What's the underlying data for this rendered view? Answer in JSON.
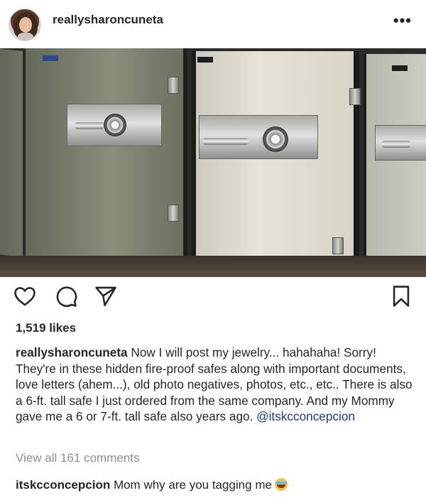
{
  "post": {
    "username": "reallysharoncuneta",
    "more_label": "•••",
    "photo_badges": [
      "Mosler",
      "Mosler"
    ],
    "likes": "1,519 likes",
    "caption": {
      "username": "reallysharoncuneta",
      "text": " Now I will post my jewelry... hahahaha! Sorry! They're in these hidden fire-proof safes along with important documents, love letters (ahem...), old photo negatives, photos, etc., etc.. There is also a 6-ft. tall safe I just ordered from the same company. And my Mommy gave me a 6 or 7-ft. tall safe also years ago. ",
      "mention": "@itskcconcepcion"
    },
    "view_all_comments": "View all 161 comments",
    "comment": {
      "username": "itskcconcepcion",
      "text": " Mom why are you tagging me",
      "emoji": "face-with-tears-of-joy"
    }
  },
  "icons": {
    "like": "heart-icon",
    "comment": "comment-icon",
    "share": "share-icon",
    "save": "bookmark-icon"
  }
}
